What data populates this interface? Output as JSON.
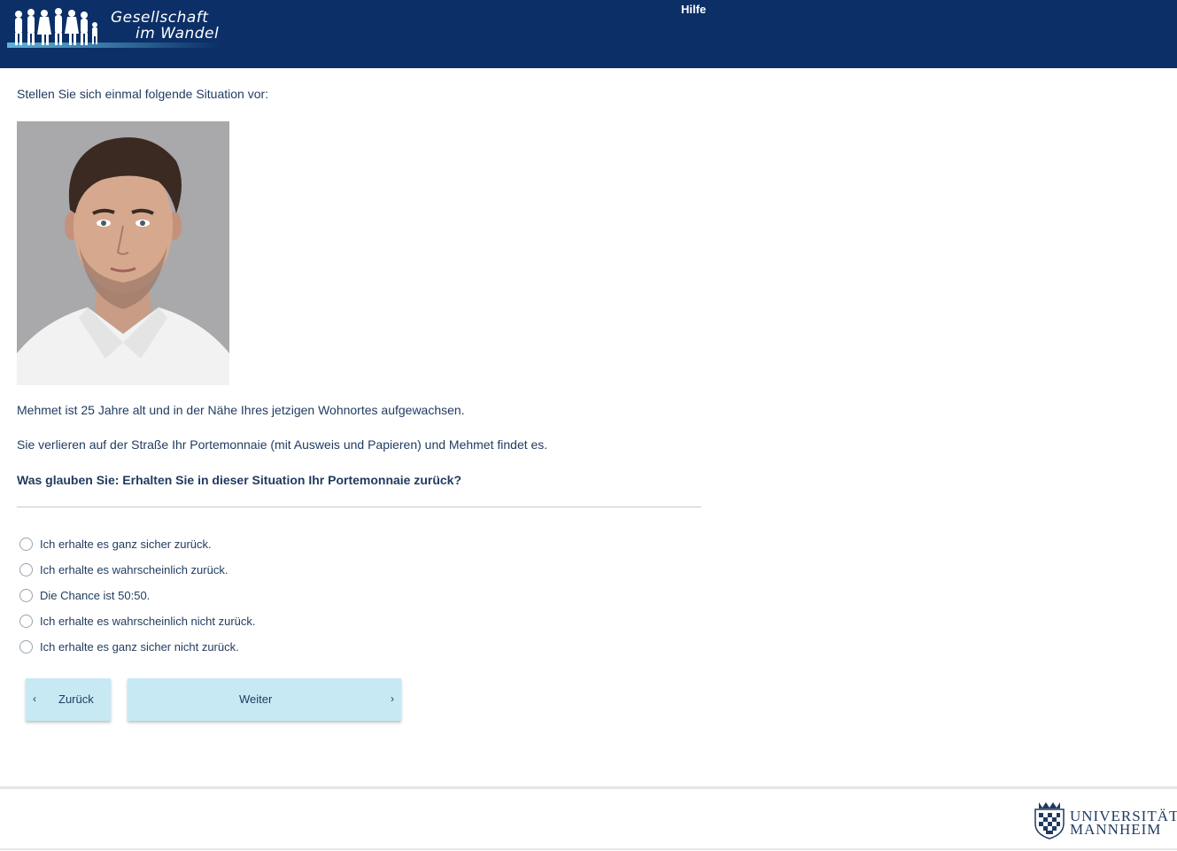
{
  "header": {
    "logo_line1": "Gesellschaft",
    "logo_line2": "im Wandel",
    "help_label": "Hilfe"
  },
  "main": {
    "intro": "Stellen Sie sich einmal folgende Situation vor:",
    "vignette_line1": "Mehmet ist 25 Jahre alt und in der Nähe Ihres jetzigen Wohnortes aufgewachsen.",
    "vignette_line2": "Sie verlieren auf der Straße Ihr Portemonnaie (mit Ausweis und Papieren) und Mehmet findet es.",
    "question": "Was glauben Sie: Erhalten Sie in dieser Situation Ihr Portemonnaie zurück?",
    "options": [
      "Ich erhalte es ganz sicher zurück.",
      "Ich erhalte es wahrscheinlich zurück.",
      "Die Chance ist 50:50.",
      "Ich erhalte es wahrscheinlich nicht zurück.",
      "Ich erhalte es ganz sicher nicht zurück."
    ]
  },
  "navigation": {
    "back_label": "Zurück",
    "next_label": "Weiter",
    "back_icon": "chevron-left-icon",
    "next_icon": "chevron-right-icon"
  },
  "footer": {
    "university_line1": "UNIVERSITÄT",
    "university_line2": "MANNHEIM"
  },
  "colors": {
    "header_bg": "#0b2f66",
    "button_bg": "#c7e9f4",
    "text": "#1f3a5f"
  }
}
